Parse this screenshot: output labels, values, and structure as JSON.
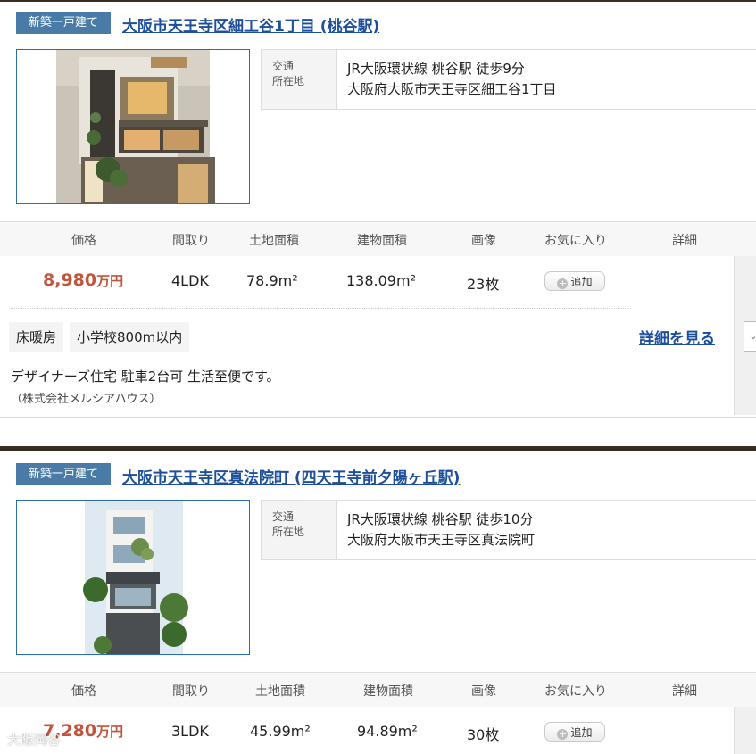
{
  "listings": [
    {
      "badge": "新築一戸建て",
      "title": "大阪市天王寺区細工谷1丁目 (桃谷駅)",
      "info_label_1": "交通",
      "info_label_2": "所在地",
      "access": "JR大阪環状線 桃谷駅 徒歩9分",
      "address": "大阪府大阪市天王寺区細工谷1丁目",
      "price_value": "8,980",
      "price_unit": "万円",
      "layout": "4LDK",
      "land_area": "78.9m²",
      "building_area": "138.09m²",
      "images": "23枚",
      "fav_button": "追加",
      "tags": [
        "床暖房",
        "小学校800m以内"
      ],
      "detail_link": "詳細を見る",
      "description": "デザイナーズ住宅 駐車2台可 生活至便です。",
      "company": "（株式会社メルシアハウス）"
    },
    {
      "badge": "新築一戸建て",
      "title": "大阪市天王寺区真法院町 (四天王寺前夕陽ヶ丘駅)",
      "info_label_1": "交通",
      "info_label_2": "所在地",
      "access": "JR大阪環状線 桃谷駅 徒歩10分",
      "address": "大阪府大阪市天王寺区真法院町",
      "price_value": "7,280",
      "price_unit": "万円",
      "layout": "3LDK",
      "land_area": "45.99m²",
      "building_area": "94.89m²",
      "images": "30枚",
      "fav_button": "追加"
    }
  ],
  "table_headers": {
    "price": "価格",
    "layout": "間取り",
    "land": "土地面積",
    "building": "建物面積",
    "images": "画像",
    "favorite": "お気に入り",
    "detail": "詳細"
  },
  "watermark": "大阪岡谷",
  "colors": {
    "badge_bg": "#4a7ba6",
    "title_link": "#1c4f9c",
    "price": "#c1553d"
  },
  "icons": [
    "plus-circle-icon",
    "chevron-icon"
  ]
}
